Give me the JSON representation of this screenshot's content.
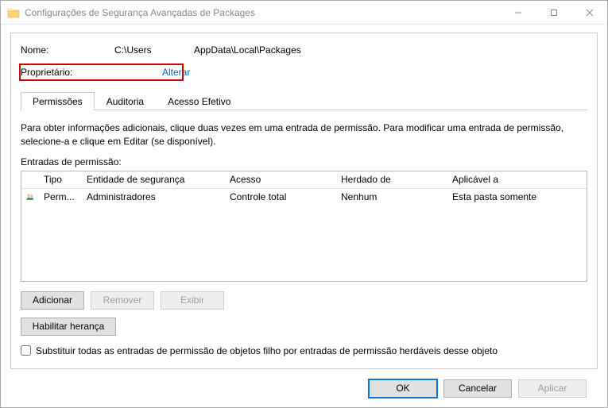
{
  "window": {
    "title": "Configurações de Segurança Avançadas de Packages"
  },
  "info": {
    "name_label": "Nome:",
    "name_value1": "C:\\Users",
    "name_value2": "AppData\\Local\\Packages",
    "owner_label": "Proprietário:",
    "owner_change": "Alterar"
  },
  "tabs": [
    {
      "label": "Permissões",
      "active": true
    },
    {
      "label": "Auditoria",
      "active": false
    },
    {
      "label": "Acesso Efetivo",
      "active": false
    }
  ],
  "help_text": "Para obter informações adicionais, clique duas vezes em uma entrada de permissão. Para modificar uma entrada de permissão, selecione-a e clique em Editar (se disponível).",
  "list_caption": "Entradas de permissão:",
  "list_headers": {
    "tipo": "Tipo",
    "entidade": "Entidade de segurança",
    "acesso": "Acesso",
    "herdado": "Herdado de",
    "aplicavel": "Aplicável a"
  },
  "list_rows": [
    {
      "tipo": "Perm...",
      "entidade": "Administradores",
      "acesso": "Controle total",
      "herdado": "Nenhum",
      "aplicavel": "Esta pasta somente"
    }
  ],
  "buttons": {
    "add": "Adicionar",
    "remove": "Remover",
    "view": "Exibir",
    "enable_inherit": "Habilitar herança"
  },
  "checkbox_label": "Substituir todas as entradas de permissão de objetos filho por entradas de permissão herdáveis desse objeto",
  "dialog_buttons": {
    "ok": "OK",
    "cancel": "Cancelar",
    "apply": "Aplicar"
  }
}
